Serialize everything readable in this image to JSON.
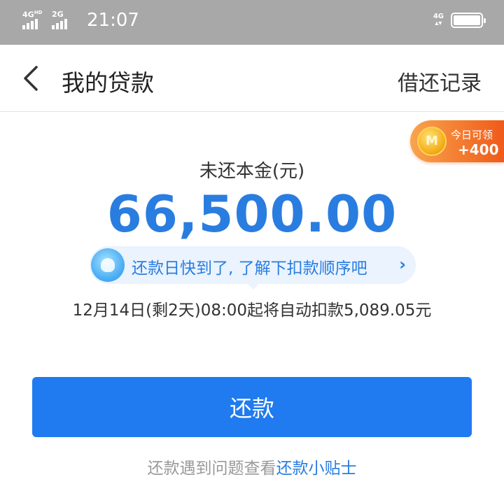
{
  "status_bar": {
    "network_1": "4G",
    "network_1_sup": "HD",
    "network_2": "2G",
    "time": "21:07",
    "network_right": "4G"
  },
  "header": {
    "title": "我的贷款",
    "history_link": "借还记录"
  },
  "bonus": {
    "coin_symbol": "M",
    "label": "今日可领",
    "amount": "+400"
  },
  "loan": {
    "principal_label": "未还本金(元)",
    "principal_amount": "66,500.00"
  },
  "tip": {
    "text": "还款日快到了, 了解下扣款顺序吧",
    "chevron": "›"
  },
  "auto_debit": "12月14日(剩2天)08:00起将自动扣款5,089.05元",
  "repay_button": "还款",
  "help": {
    "prefix": "还款遇到问题查看",
    "link": "还款小贴士"
  },
  "colors": {
    "accent": "#1f7bef",
    "amount_blue": "#2a7de0",
    "bonus_orange": "#f05a1a"
  }
}
